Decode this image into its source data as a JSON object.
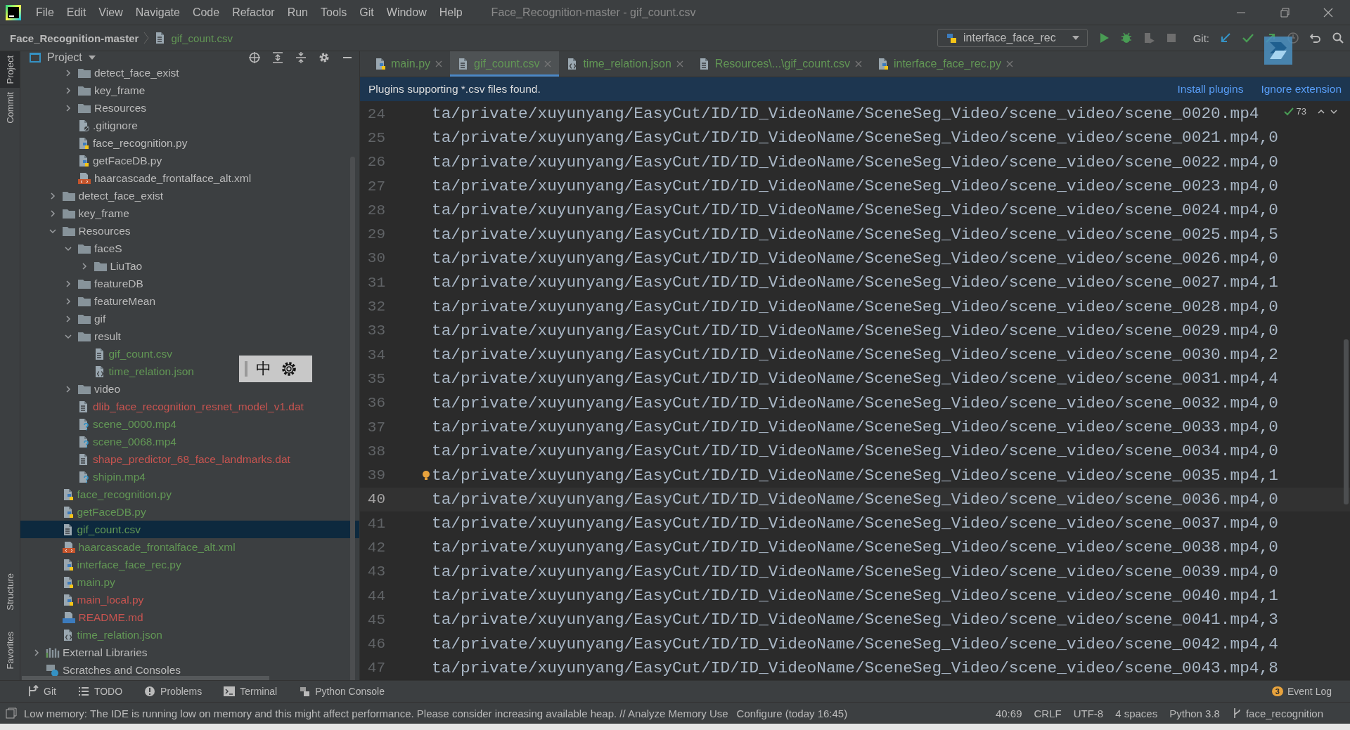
{
  "window": {
    "title": "Face_Recognition-master - gif_count.csv"
  },
  "menu": [
    "File",
    "Edit",
    "View",
    "Navigate",
    "Code",
    "Refactor",
    "Run",
    "Tools",
    "Git",
    "Window",
    "Help"
  ],
  "breadcrumb": [
    {
      "label": "Face_Recognition-master",
      "kind": "project"
    },
    {
      "label": "gif_count.csv",
      "kind": "csv"
    }
  ],
  "toolbar": {
    "run_config": "interface_face_rec",
    "git_label": "Git:"
  },
  "project_panel": {
    "title": "Project",
    "clipped_branch": [
      {
        "label": "detect_face_exist",
        "kind": "folder",
        "color": "#bbbbbb",
        "expanded": false,
        "selected": false
      },
      {
        "label": "key_frame",
        "kind": "folder",
        "color": "#bbbbbb",
        "expanded": false,
        "selected": false
      },
      {
        "label": "Resources",
        "kind": "folder",
        "color": "#bbbbbb",
        "expanded": false,
        "selected": false
      },
      {
        "label": ".gitignore",
        "kind": "ignore",
        "color": "#bbbbbb",
        "selected": false
      },
      {
        "label": "face_recognition.py",
        "kind": "py",
        "color": "#bbbbbb",
        "selected": false
      },
      {
        "label": "getFaceDB.py",
        "kind": "py",
        "color": "#bbbbbb",
        "selected": false
      },
      {
        "label": "haarcascade_frontalface_alt.xml",
        "kind": "xml",
        "color": "#bbbbbb",
        "selected": false
      }
    ],
    "root_children": [
      {
        "label": "detect_face_exist",
        "kind": "folder",
        "color": "#bbbbbb",
        "expanded": false,
        "selected": false
      },
      {
        "label": "key_frame",
        "kind": "folder",
        "color": "#bbbbbb",
        "expanded": false,
        "selected": false
      },
      {
        "label": "Resources",
        "kind": "folder",
        "color": "#bbbbbb",
        "expanded": true,
        "selected": false,
        "children": [
          {
            "label": "faceS",
            "kind": "folder",
            "color": "#bbbbbb",
            "expanded": true,
            "selected": false,
            "children": [
              {
                "label": "LiuTao",
                "kind": "folder",
                "color": "#bbbbbb",
                "expanded": false,
                "selected": false
              }
            ]
          },
          {
            "label": "featureDB",
            "kind": "folder",
            "color": "#bbbbbb",
            "expanded": false,
            "selected": false
          },
          {
            "label": "featureMean",
            "kind": "folder",
            "color": "#bbbbbb",
            "expanded": false,
            "selected": false
          },
          {
            "label": "gif",
            "kind": "folder",
            "color": "#bbbbbb",
            "expanded": false,
            "selected": false
          },
          {
            "label": "result",
            "kind": "folder",
            "color": "#bbbbbb",
            "expanded": true,
            "selected": false,
            "children": [
              {
                "label": "gif_count.csv",
                "kind": "csv",
                "color": "#629755",
                "selected": false
              },
              {
                "label": "time_relation.json",
                "kind": "json",
                "color": "#629755",
                "selected": false
              }
            ]
          },
          {
            "label": "video",
            "kind": "folder",
            "color": "#bbbbbb",
            "expanded": false,
            "selected": false
          },
          {
            "label": "dlib_face_recognition_resnet_model_v1.dat",
            "kind": "dat",
            "color": "#c75450",
            "selected": false
          },
          {
            "label": "scene_0000.mp4",
            "kind": "unknown",
            "color": "#629755",
            "selected": false
          },
          {
            "label": "scene_0068.mp4",
            "kind": "unknown",
            "color": "#629755",
            "selected": false
          },
          {
            "label": "shape_predictor_68_face_landmarks.dat",
            "kind": "dat",
            "color": "#c75450",
            "selected": false
          },
          {
            "label": "shipin.mp4",
            "kind": "unknown",
            "color": "#629755",
            "selected": false
          }
        ]
      },
      {
        "label": "face_recognition.py",
        "kind": "py",
        "color": "#629755",
        "selected": false
      },
      {
        "label": "getFaceDB.py",
        "kind": "py",
        "color": "#629755",
        "selected": false
      },
      {
        "label": "gif_count.csv",
        "kind": "csv",
        "color": "#629755",
        "selected": true
      },
      {
        "label": "haarcascade_frontalface_alt.xml",
        "kind": "xml",
        "color": "#629755",
        "selected": false
      },
      {
        "label": "interface_face_rec.py",
        "kind": "py",
        "color": "#629755",
        "selected": false
      },
      {
        "label": "main.py",
        "kind": "py",
        "color": "#629755",
        "selected": false
      },
      {
        "label": "main_local.py",
        "kind": "py",
        "color": "#c75450",
        "selected": false
      },
      {
        "label": "README.md",
        "kind": "md",
        "color": "#c75450",
        "selected": false
      },
      {
        "label": "time_relation.json",
        "kind": "json",
        "color": "#629755",
        "selected": false
      }
    ],
    "top_level": [
      {
        "label": "External Libraries",
        "kind": "libs",
        "color": "#bbbbbb",
        "expanded": false,
        "selected": false
      },
      {
        "label": "Scratches and Consoles",
        "kind": "scratches",
        "color": "#bbbbbb",
        "selected": false
      }
    ]
  },
  "ime_toolbar": {
    "label": "中"
  },
  "side_tools": [
    {
      "label": "Project",
      "selected": true
    },
    {
      "label": "Commit",
      "selected": false
    },
    {
      "label": "Structure",
      "selected": false
    },
    {
      "label": "Favorites",
      "selected": false
    }
  ],
  "tabs": [
    {
      "label": "main.py",
      "kind": "py",
      "color": "#629755",
      "selected": false
    },
    {
      "label": "gif_count.csv",
      "kind": "csv",
      "color": "#629755",
      "selected": true
    },
    {
      "label": "time_relation.json",
      "kind": "json",
      "color": "#629755",
      "selected": false
    },
    {
      "label": "Resources\\...\\gif_count.csv",
      "kind": "csv",
      "color": "#629755",
      "selected": false
    },
    {
      "label": "interface_face_rec.py",
      "kind": "py",
      "color": "#629755",
      "selected": false
    }
  ],
  "banner": {
    "message": "Plugins supporting *.csv files found.",
    "actions": [
      "Install plugins",
      "Ignore extension"
    ]
  },
  "inspection": {
    "count": "73"
  },
  "lines": [
    {
      "number": "24",
      "text": "ta/private/xuyunyang/EasyCut/ID/ID_VideoName/SceneSeg_Video/scene_video/scene_0020.mp4",
      "current": false,
      "bulb": false
    },
    {
      "number": "25",
      "text": "ta/private/xuyunyang/EasyCut/ID/ID_VideoName/SceneSeg_Video/scene_video/scene_0021.mp4,0",
      "current": false,
      "bulb": false
    },
    {
      "number": "26",
      "text": "ta/private/xuyunyang/EasyCut/ID/ID_VideoName/SceneSeg_Video/scene_video/scene_0022.mp4,0",
      "current": false,
      "bulb": false
    },
    {
      "number": "27",
      "text": "ta/private/xuyunyang/EasyCut/ID/ID_VideoName/SceneSeg_Video/scene_video/scene_0023.mp4,0",
      "current": false,
      "bulb": false
    },
    {
      "number": "28",
      "text": "ta/private/xuyunyang/EasyCut/ID/ID_VideoName/SceneSeg_Video/scene_video/scene_0024.mp4,0",
      "current": false,
      "bulb": false
    },
    {
      "number": "29",
      "text": "ta/private/xuyunyang/EasyCut/ID/ID_VideoName/SceneSeg_Video/scene_video/scene_0025.mp4,5",
      "current": false,
      "bulb": false
    },
    {
      "number": "30",
      "text": "ta/private/xuyunyang/EasyCut/ID/ID_VideoName/SceneSeg_Video/scene_video/scene_0026.mp4,0",
      "current": false,
      "bulb": false
    },
    {
      "number": "31",
      "text": "ta/private/xuyunyang/EasyCut/ID/ID_VideoName/SceneSeg_Video/scene_video/scene_0027.mp4,1",
      "current": false,
      "bulb": false
    },
    {
      "number": "32",
      "text": "ta/private/xuyunyang/EasyCut/ID/ID_VideoName/SceneSeg_Video/scene_video/scene_0028.mp4,0",
      "current": false,
      "bulb": false
    },
    {
      "number": "33",
      "text": "ta/private/xuyunyang/EasyCut/ID/ID_VideoName/SceneSeg_Video/scene_video/scene_0029.mp4,0",
      "current": false,
      "bulb": false
    },
    {
      "number": "34",
      "text": "ta/private/xuyunyang/EasyCut/ID/ID_VideoName/SceneSeg_Video/scene_video/scene_0030.mp4,2",
      "current": false,
      "bulb": false
    },
    {
      "number": "35",
      "text": "ta/private/xuyunyang/EasyCut/ID/ID_VideoName/SceneSeg_Video/scene_video/scene_0031.mp4,4",
      "current": false,
      "bulb": false
    },
    {
      "number": "36",
      "text": "ta/private/xuyunyang/EasyCut/ID/ID_VideoName/SceneSeg_Video/scene_video/scene_0032.mp4,0",
      "current": false,
      "bulb": false
    },
    {
      "number": "37",
      "text": "ta/private/xuyunyang/EasyCut/ID/ID_VideoName/SceneSeg_Video/scene_video/scene_0033.mp4,0",
      "current": false,
      "bulb": false
    },
    {
      "number": "38",
      "text": "ta/private/xuyunyang/EasyCut/ID/ID_VideoName/SceneSeg_Video/scene_video/scene_0034.mp4,0",
      "current": false,
      "bulb": false
    },
    {
      "number": "39",
      "text": "ta/private/xuyunyang/EasyCut/ID/ID_VideoName/SceneSeg_Video/scene_video/scene_0035.mp4,1",
      "current": false,
      "bulb": true
    },
    {
      "number": "40",
      "text": "ta/private/xuyunyang/EasyCut/ID/ID_VideoName/SceneSeg_Video/scene_video/scene_0036.mp4,0",
      "current": true,
      "bulb": false
    },
    {
      "number": "41",
      "text": "ta/private/xuyunyang/EasyCut/ID/ID_VideoName/SceneSeg_Video/scene_video/scene_0037.mp4,0",
      "current": false,
      "bulb": false
    },
    {
      "number": "42",
      "text": "ta/private/xuyunyang/EasyCut/ID/ID_VideoName/SceneSeg_Video/scene_video/scene_0038.mp4,0",
      "current": false,
      "bulb": false
    },
    {
      "number": "43",
      "text": "ta/private/xuyunyang/EasyCut/ID/ID_VideoName/SceneSeg_Video/scene_video/scene_0039.mp4,0",
      "current": false,
      "bulb": false
    },
    {
      "number": "44",
      "text": "ta/private/xuyunyang/EasyCut/ID/ID_VideoName/SceneSeg_Video/scene_video/scene_0040.mp4,1",
      "current": false,
      "bulb": false
    },
    {
      "number": "45",
      "text": "ta/private/xuyunyang/EasyCut/ID/ID_VideoName/SceneSeg_Video/scene_video/scene_0041.mp4,3",
      "current": false,
      "bulb": false
    },
    {
      "number": "46",
      "text": "ta/private/xuyunyang/EasyCut/ID/ID_VideoName/SceneSeg_Video/scene_video/scene_0042.mp4,4",
      "current": false,
      "bulb": false
    },
    {
      "number": "47",
      "text": "ta/private/xuyunyang/EasyCut/ID/ID_VideoName/SceneSeg_Video/scene_video/scene_0043.mp4,8",
      "current": false,
      "bulb": false
    }
  ],
  "tool_windows": [
    {
      "label": "Git",
      "kind": "git"
    },
    {
      "label": "TODO",
      "kind": "todo"
    },
    {
      "label": "Problems",
      "kind": "problems"
    },
    {
      "label": "Terminal",
      "kind": "terminal"
    },
    {
      "label": "Python Console",
      "kind": "python"
    }
  ],
  "event_log": {
    "label": "Event Log",
    "count": "3"
  },
  "status_bar": {
    "message": "Low memory: The IDE is running low on memory and this might affect performance. Please consider increasing available heap. // Analyze Memory Use",
    "configure": "Configure (today 16:45)",
    "items": [
      "40:69",
      "CRLF",
      "UTF-8",
      "4 spaces",
      "Python 3.8"
    ],
    "branch": "face_recognition"
  }
}
